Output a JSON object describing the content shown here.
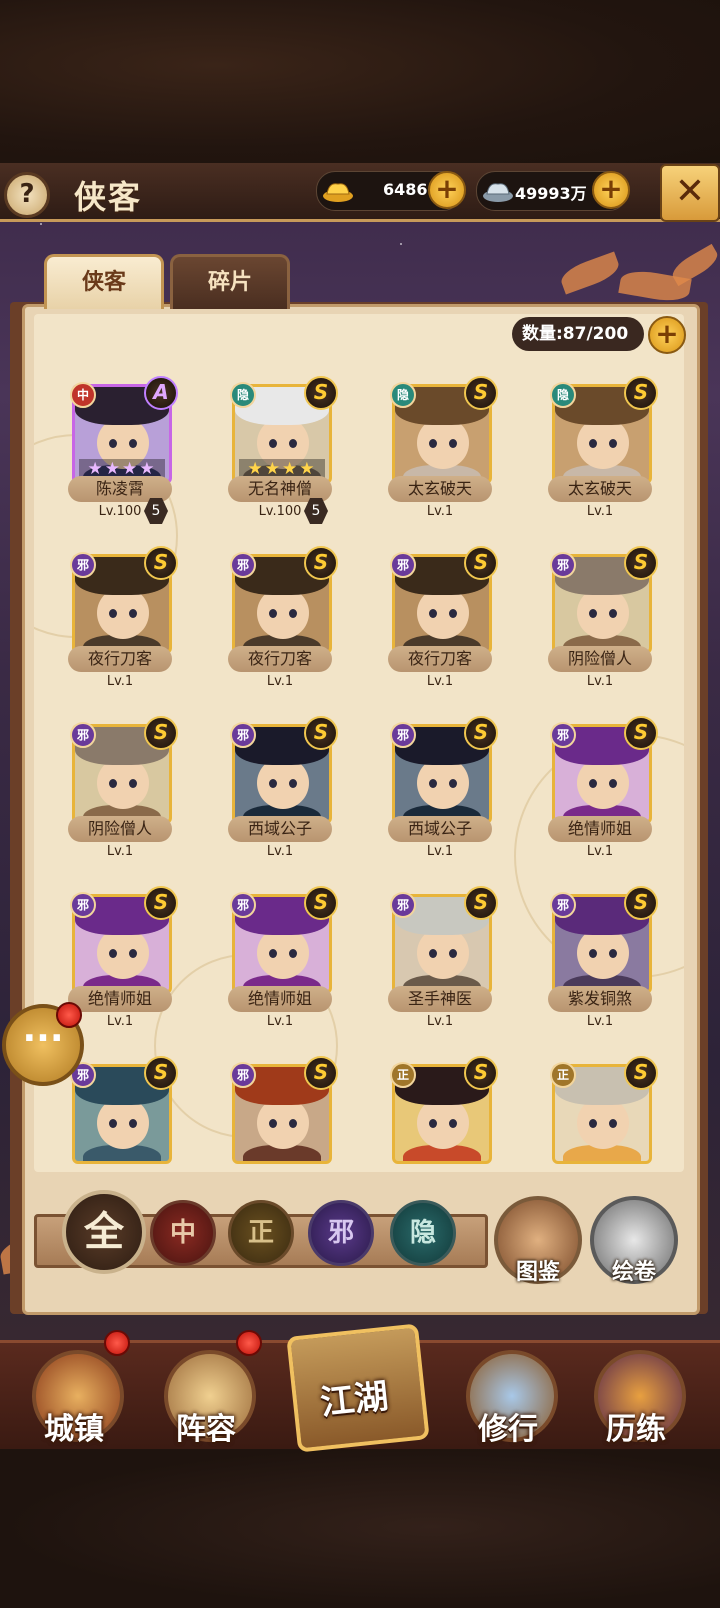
{
  "header": {
    "title": "侠客",
    "help_icon_text": "?",
    "gold": "6486",
    "silver": "49993万",
    "close_icon": "✕"
  },
  "tabs": [
    {
      "label": "侠客",
      "active": true
    },
    {
      "label": "碎片",
      "active": false
    }
  ],
  "count": {
    "label": "数量:87/200"
  },
  "heroes": [
    {
      "name": "陈凌霄",
      "level": "Lv.100",
      "badge": "5",
      "faction": "中",
      "grade": "A",
      "stars": "★★★★",
      "rarity": "purple"
    },
    {
      "name": "无名神僧",
      "level": "Lv.100",
      "badge": "5",
      "faction": "隐",
      "grade": "S",
      "stars": "★★★★",
      "rarity": "gold"
    },
    {
      "name": "太玄破天",
      "level": "Lv.1",
      "faction": "隐",
      "grade": "S",
      "rarity": "gold"
    },
    {
      "name": "太玄破天",
      "level": "Lv.1",
      "faction": "隐",
      "grade": "S",
      "rarity": "gold"
    },
    {
      "name": "夜行刀客",
      "level": "Lv.1",
      "faction": "邪",
      "grade": "S",
      "rarity": "gold"
    },
    {
      "name": "夜行刀客",
      "level": "Lv.1",
      "faction": "邪",
      "grade": "S",
      "rarity": "gold"
    },
    {
      "name": "夜行刀客",
      "level": "Lv.1",
      "faction": "邪",
      "grade": "S",
      "rarity": "gold"
    },
    {
      "name": "阴险僧人",
      "level": "Lv.1",
      "faction": "邪",
      "grade": "S",
      "rarity": "gold"
    },
    {
      "name": "阴险僧人",
      "level": "Lv.1",
      "faction": "邪",
      "grade": "S",
      "rarity": "gold"
    },
    {
      "name": "西域公子",
      "level": "Lv.1",
      "faction": "邪",
      "grade": "S",
      "rarity": "gold"
    },
    {
      "name": "西域公子",
      "level": "Lv.1",
      "faction": "邪",
      "grade": "S",
      "rarity": "gold"
    },
    {
      "name": "绝情师姐",
      "level": "Lv.1",
      "faction": "邪",
      "grade": "S",
      "rarity": "gold"
    },
    {
      "name": "绝情师姐",
      "level": "Lv.1",
      "faction": "邪",
      "grade": "S",
      "rarity": "gold"
    },
    {
      "name": "绝情师姐",
      "level": "Lv.1",
      "faction": "邪",
      "grade": "S",
      "rarity": "gold"
    },
    {
      "name": "圣手神医",
      "level": "Lv.1",
      "faction": "邪",
      "grade": "S",
      "rarity": "gold"
    },
    {
      "name": "紫发铜煞",
      "level": "Lv.1",
      "faction": "邪",
      "grade": "S",
      "rarity": "gold"
    },
    {
      "name": "",
      "level": "",
      "faction": "邪",
      "grade": "S",
      "rarity": "gold"
    },
    {
      "name": "",
      "level": "",
      "faction": "邪",
      "grade": "S",
      "rarity": "gold"
    },
    {
      "name": "",
      "level": "",
      "faction": "正",
      "grade": "S",
      "rarity": "gold"
    },
    {
      "name": "",
      "level": "",
      "faction": "正",
      "grade": "S",
      "rarity": "gold"
    }
  ],
  "filters": {
    "all": "全",
    "zhong": "中",
    "zheng": "正",
    "xie": "邪",
    "yin": "隐"
  },
  "side_buttons": {
    "guide": "图鉴",
    "scroll": "绘卷"
  },
  "chat": {
    "icon_text": "···"
  },
  "nav": {
    "town": "城镇",
    "lineup": "阵容",
    "jianghu": "江湖",
    "practice": "修行",
    "training": "历练"
  },
  "colors": {
    "faction_zhong": "#c0342a",
    "faction_zheng": "#a0762a",
    "faction_xie": "#6a3a9a",
    "faction_yin": "#2a8a7a",
    "gold_frame": "#e8b43a",
    "purple_frame": "#c766e6"
  }
}
